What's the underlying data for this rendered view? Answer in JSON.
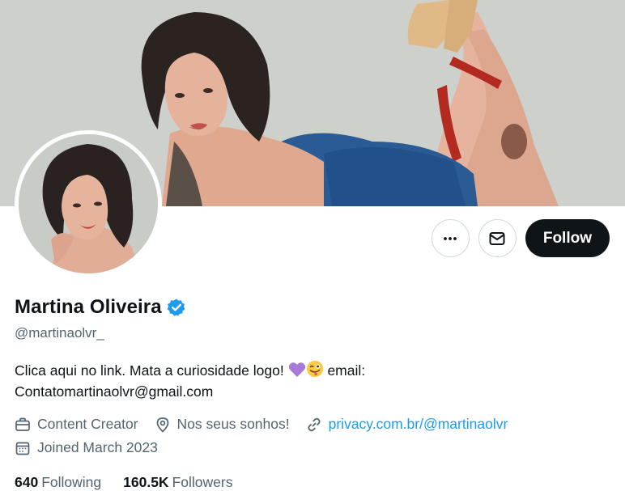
{
  "profile": {
    "display_name": "Martina Oliveira",
    "handle": "@martinaolvr_",
    "verified_icon": "verified-badge-icon",
    "bio_line1": "Clica aqui no link. Mata a curiosidade logo!",
    "bio_after_emoji": "email:",
    "bio_line2": "Contatomartinaolvr@gmail.com",
    "emojis": [
      "purple-heart-icon",
      "winking-tongue-face-icon"
    ]
  },
  "meta": {
    "category": "Content Creator",
    "location": "Nos seus sonhos!",
    "website": "privacy.com.br/@martinaolvr",
    "joined": "Joined March 2023"
  },
  "stats": {
    "following_count": "640",
    "following_label": "Following",
    "followers_count": "160.5K",
    "followers_label": "Followers"
  },
  "actions": {
    "more_icon": "more-icon",
    "message_icon": "envelope-icon",
    "follow_label": "Follow"
  },
  "colors": {
    "accent": "#1d9bf0",
    "follow_bg": "#0f1419",
    "muted_text": "#536471",
    "verified": "#1d9bf0"
  }
}
